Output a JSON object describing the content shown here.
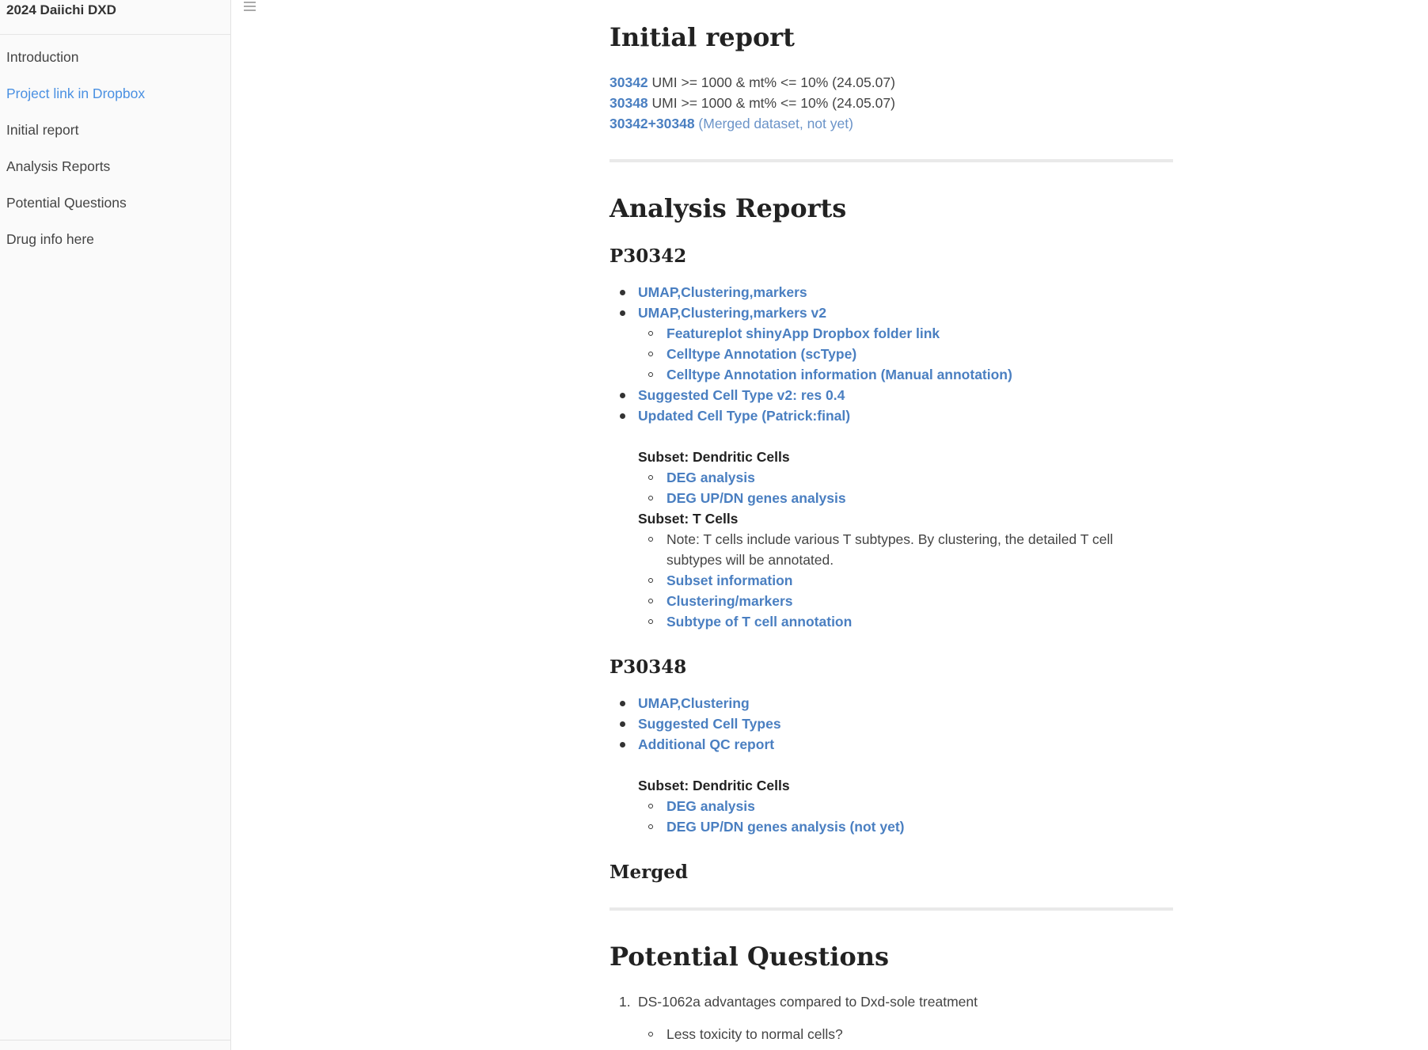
{
  "sidebar": {
    "title": "2024 Daiichi DXD",
    "items": [
      {
        "label": "Introduction"
      },
      {
        "label": "Project link in Dropbox"
      },
      {
        "label": "Initial report"
      },
      {
        "label": "Analysis Reports"
      },
      {
        "label": "Potential Questions"
      },
      {
        "label": "Drug info here"
      }
    ]
  },
  "toolbar": {
    "menu_icon": "hamburger-icon"
  },
  "initial_report": {
    "heading": "Initial report",
    "rows": [
      {
        "id": "30342",
        "text": " UMI >= 1000 & mt% <= 10% (24.05.07)"
      },
      {
        "id": "30348",
        "text": " UMI >= 1000 & mt% <= 10% (24.05.07)"
      },
      {
        "id": "30342+30348",
        "text": " (Merged dataset, not yet)"
      }
    ]
  },
  "analysis": {
    "heading": "Analysis Reports",
    "p30342": {
      "heading": "P30342",
      "items": [
        "UMAP,Clustering,markers",
        "UMAP,Clustering,markers v2",
        "Featureplot shinyApp Dropbox folder link",
        "Celltype Annotation (scType)",
        "Celltype Annotation information (Manual annotation)",
        "Suggested Cell Type v2: res 0.4",
        "Updated Cell Type (Patrick:final)"
      ],
      "subset_dc": "Subset: Dendritic Cells",
      "dc_items": [
        "DEG analysis",
        "DEG UP/DN genes analysis"
      ],
      "subset_t": "Subset: T Cells",
      "t_note": "Note: T cells include various T subtypes. By clustering, the detailed T cell subtypes will be annotated.",
      "t_items": [
        "Subset information",
        "Clustering/markers",
        "Subtype of T cell annotation"
      ]
    },
    "p30348": {
      "heading": "P30348",
      "items": [
        "UMAP,Clustering",
        "Suggested Cell Types",
        "Additional QC report"
      ],
      "subset_dc": "Subset: Dendritic Cells",
      "dc_items": [
        "DEG analysis",
        "DEG UP/DN genes analysis (not yet)"
      ]
    },
    "merged": {
      "heading": "Merged"
    }
  },
  "questions": {
    "heading": "Potential Questions",
    "q1": "DS-1062a advantages compared to Dxd-sole treatment",
    "q1_marker": "1.",
    "q1_sub": [
      "Less toxicity to normal cells?"
    ]
  }
}
